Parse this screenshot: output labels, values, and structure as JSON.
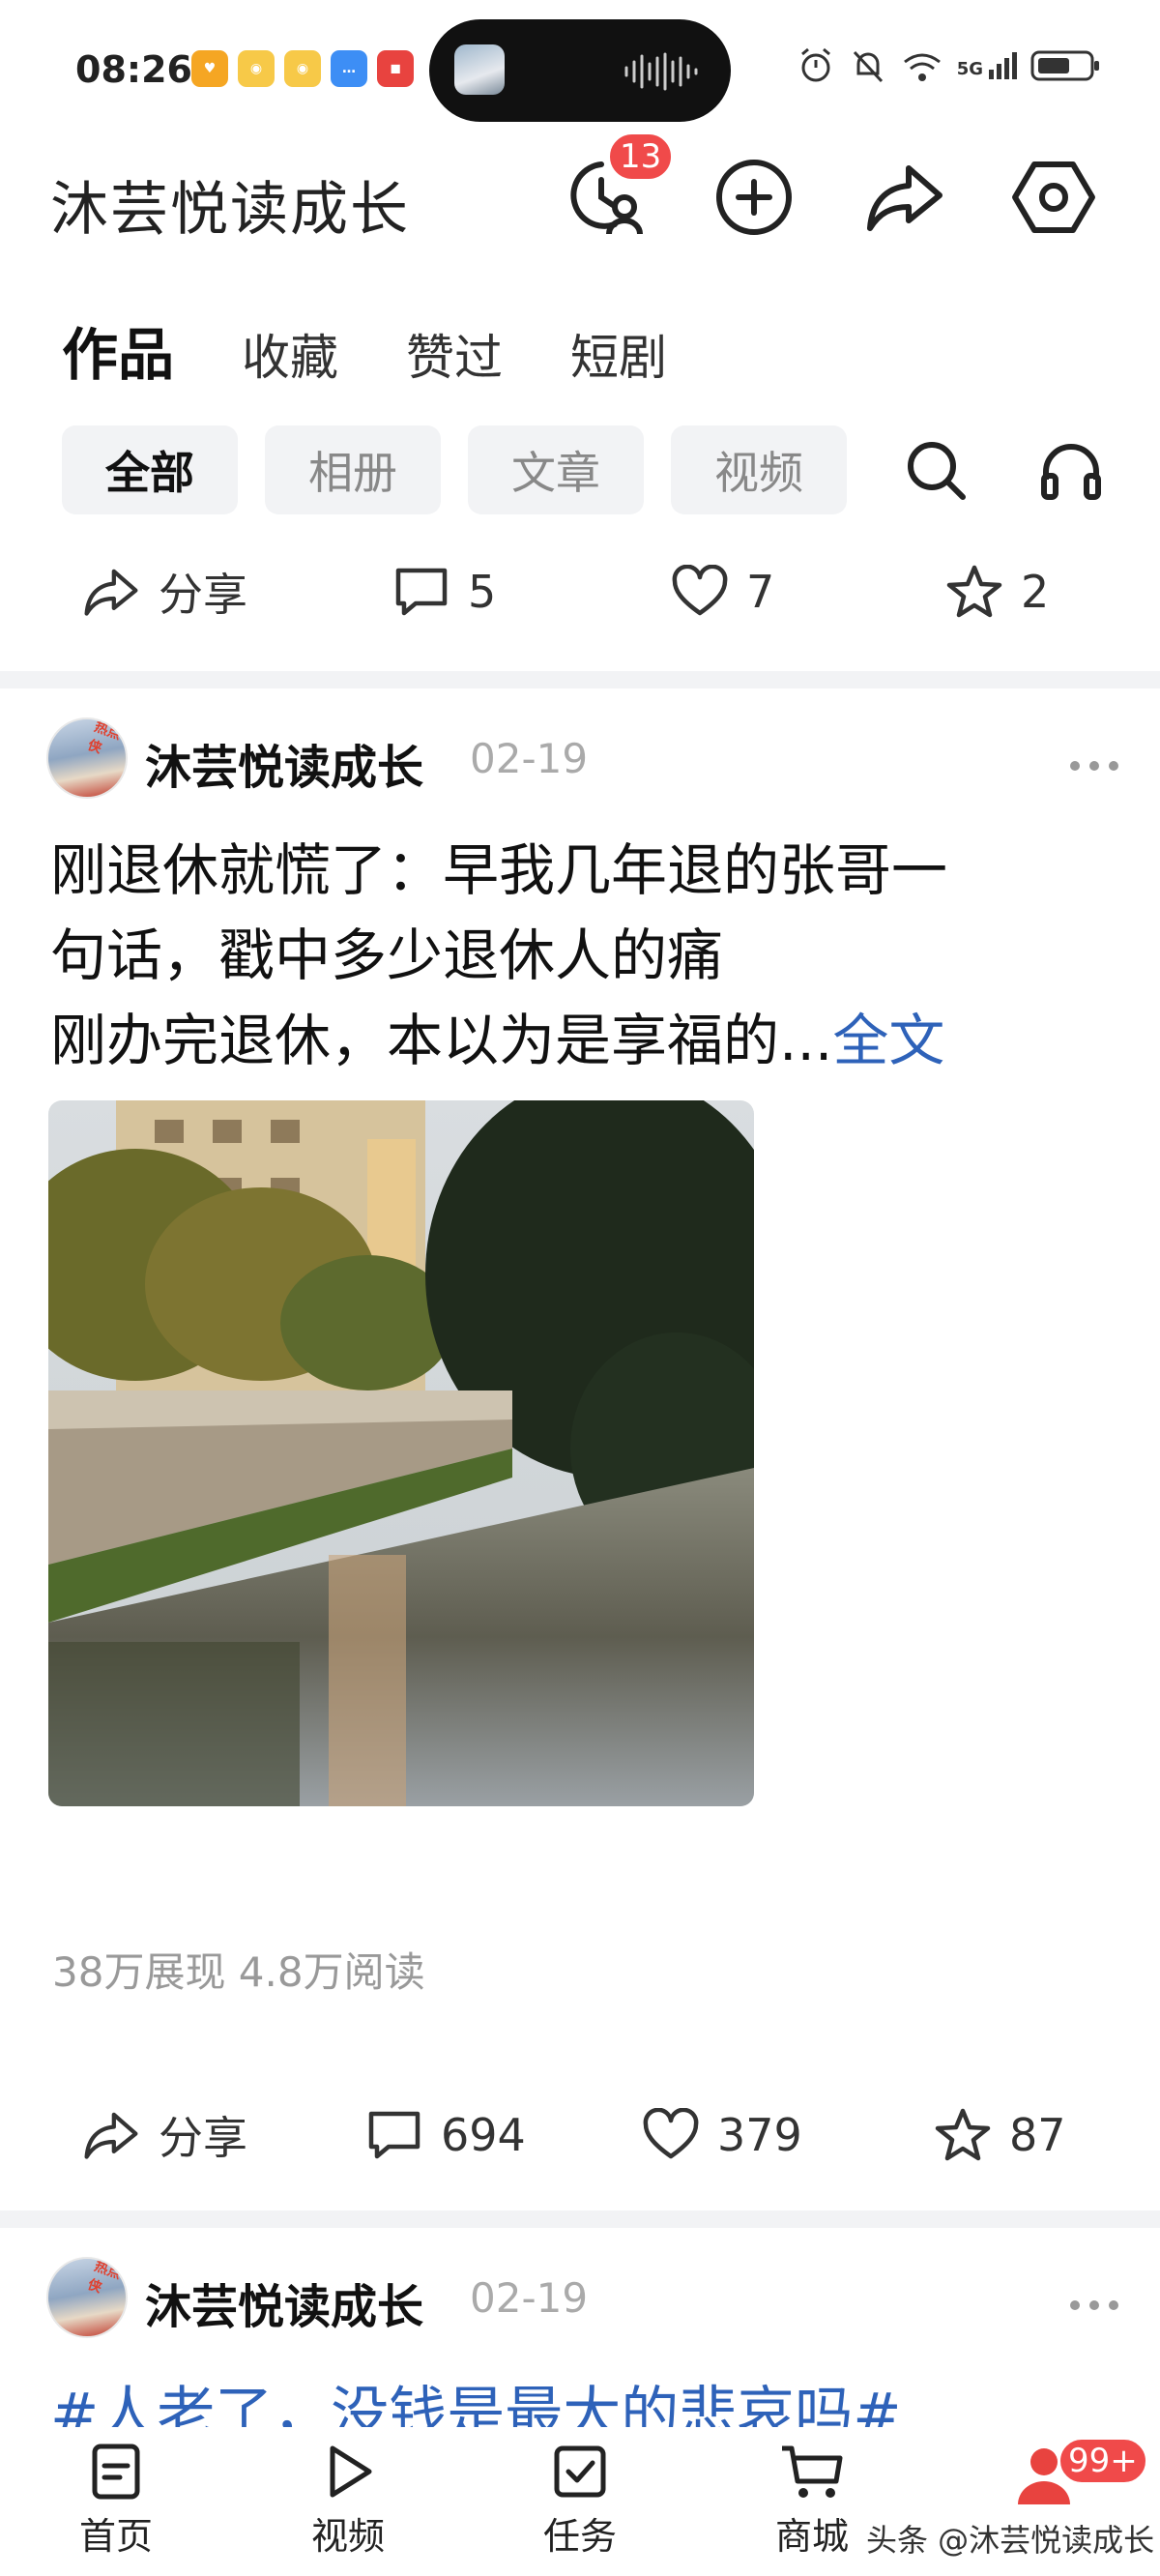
{
  "status_bar": {
    "time": "08:26",
    "network": "5G",
    "icons": [
      "alarm-icon",
      "mute-icon",
      "wifi-icon",
      "signal-icon",
      "battery-icon"
    ]
  },
  "header": {
    "title": "沐芸悦读成长",
    "history_badge": "13"
  },
  "tabs": [
    "作品",
    "收藏",
    "赞过",
    "短剧"
  ],
  "filters": [
    "全部",
    "相册",
    "文章",
    "视频"
  ],
  "first_actions": {
    "share": "分享",
    "comments": "5",
    "likes": "7",
    "favorites": "2"
  },
  "post": {
    "author": "沐芸悦读成长",
    "date": "02-19",
    "avatar_tag": "热点侠",
    "line1": "刚退休就慌了：早我几年退的张哥一",
    "line2": "句话，戳中多少退休人的痛",
    "line3": "刚办完退休，本以为是享福的...",
    "full_text_link": "全文",
    "stats": "38万展现   4.8万阅读",
    "actions": {
      "share": "分享",
      "comments": "694",
      "likes": "379",
      "favorites": "87"
    }
  },
  "next_post": {
    "author": "沐芸悦读成长",
    "date": "02-19",
    "hashtag": "#人老了，没钱是最大的悲哀吗#"
  },
  "bottom_nav": {
    "items": [
      "首页",
      "视频",
      "任务",
      "商城"
    ],
    "me_badge": "99+",
    "watermark": "头条 @沐芸悦读成长"
  },
  "colors": {
    "accent_blue": "#2e62b9",
    "badge_red": "#f04a4a",
    "chip_bg": "#f2f3f5"
  }
}
